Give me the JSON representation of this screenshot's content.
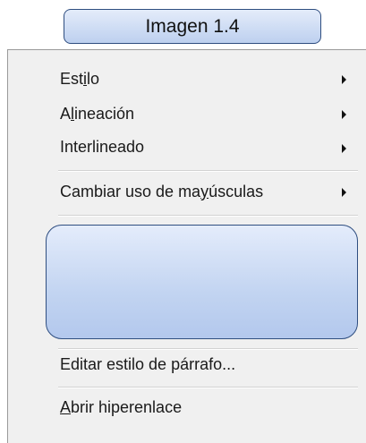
{
  "caption": {
    "text": "Imagen 1.4"
  },
  "menu": {
    "items": [
      {
        "label_parts": [
          "Est",
          "i",
          "lo"
        ],
        "has_submenu": true
      },
      {
        "label_parts": [
          "A",
          "l",
          "ineación"
        ],
        "has_submenu": true
      },
      {
        "label_parts": [
          "Interlineado",
          "",
          ""
        ],
        "has_submenu": true
      },
      {
        "label_parts": [
          "Cambiar uso de ma",
          "y",
          "úsculas"
        ],
        "has_submenu": true
      },
      {
        "label_parts": [
          "Editar estilo de párrafo...",
          "",
          ""
        ],
        "has_submenu": false
      },
      {
        "label_parts": [
          "",
          "A",
          "brir hiperenlace"
        ],
        "has_submenu": false
      }
    ]
  },
  "colors": {
    "menu_background": "#f0f0f0",
    "accent_border": "#2f4e80",
    "box_fill_top": "#e4ecfa",
    "box_fill_bottom": "#bdd0ef"
  }
}
